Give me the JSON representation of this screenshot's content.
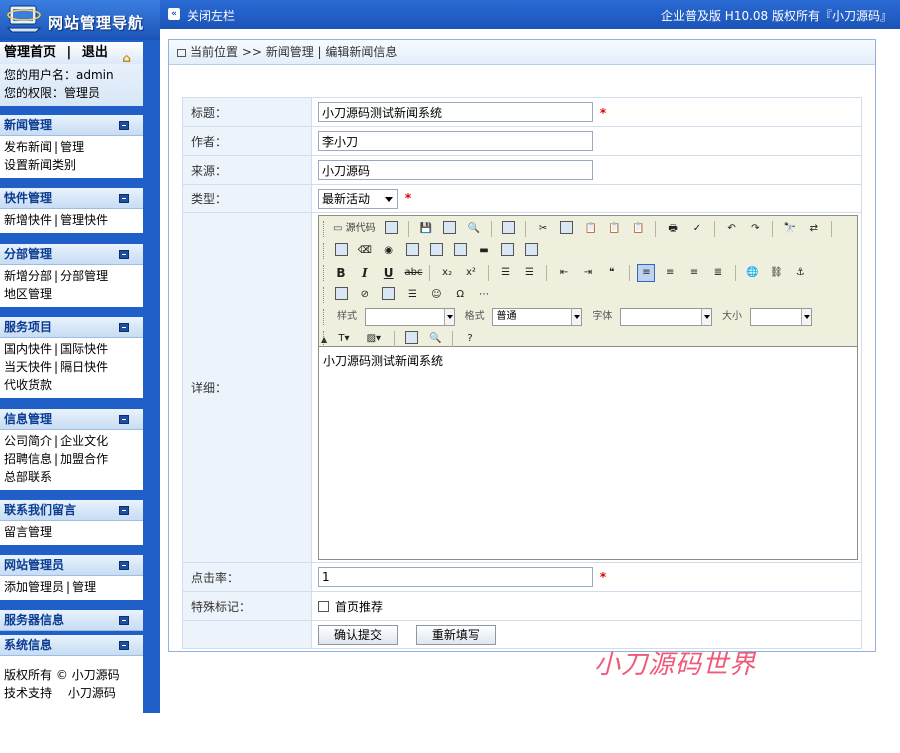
{
  "sidebar": {
    "logo_title": "网站管理导航",
    "home": {
      "home_label": "管理首页",
      "sep": "|",
      "logout_label": "退出",
      "user_line": "您的用户名：admin",
      "perm_line": "您的权限：管理员"
    },
    "sections": [
      {
        "title": "新闻管理",
        "rows": [
          [
            "发布新闻",
            "管理"
          ],
          [
            "设置新闻类别"
          ]
        ]
      },
      {
        "title": "快件管理",
        "rows": [
          [
            "新增快件",
            "管理快件"
          ]
        ]
      },
      {
        "title": "分部管理",
        "rows": [
          [
            "新增分部",
            "分部管理"
          ],
          [
            "地区管理"
          ]
        ]
      },
      {
        "title": "服务项目",
        "rows": [
          [
            "国内快件",
            "国际快件"
          ],
          [
            "当天快件",
            "隔日快件"
          ],
          [
            "代收货款"
          ]
        ]
      },
      {
        "title": "信息管理",
        "rows": [
          [
            "公司简介",
            "企业文化"
          ],
          [
            "招聘信息",
            "加盟合作"
          ],
          [
            "总部联系"
          ]
        ]
      },
      {
        "title": "联系我们留言",
        "rows": [
          [
            "留言管理"
          ]
        ]
      },
      {
        "title": "网站管理员",
        "rows": [
          [
            "添加管理员",
            "管理"
          ]
        ]
      },
      {
        "title": "服务器信息",
        "rows": []
      },
      {
        "title": "系统信息",
        "rows": [
          [
            "版权所有 © 小刀源码"
          ],
          [
            "技术支持　 小刀源码"
          ]
        ]
      }
    ]
  },
  "topbar": {
    "close_left": "关闭左栏",
    "edition": "企业普及版  H10.08  版权所有『小刀源码』"
  },
  "breadcrumb": "当前位置 >> 新闻管理 | 编辑新闻信息",
  "form": {
    "title_label": "标题：",
    "title_value": "小刀源码测试新闻系统",
    "author_label": "作者：",
    "author_value": "李小刀",
    "source_label": "来源：",
    "source_value": "小刀源码",
    "type_label": "类型：",
    "type_value": "最新活动",
    "detail_label": "详细：",
    "detail_content": "小刀源码测试新闻系统",
    "hits_label": "点击率：",
    "hits_value": "1",
    "special_label": "特殊标记：",
    "special_option": "首页推荐",
    "required_mark": "*",
    "submit_label": "确认提交",
    "reset_label": "重新填写"
  },
  "editor": {
    "source_btn": "源代码",
    "style_label": "样式",
    "format_label": "格式",
    "format_value": "普通",
    "font_label": "字体",
    "size_label": "大小"
  },
  "watermark": "小刀源码世界",
  "colors": {
    "sidebar_bg": "#1f5fc7",
    "topbar_bg": "#1b54b8",
    "label_bg": "#edf3fb",
    "toolbar_bg": "#efefde",
    "required": "#dd0000",
    "watermark": "#f05a78"
  }
}
